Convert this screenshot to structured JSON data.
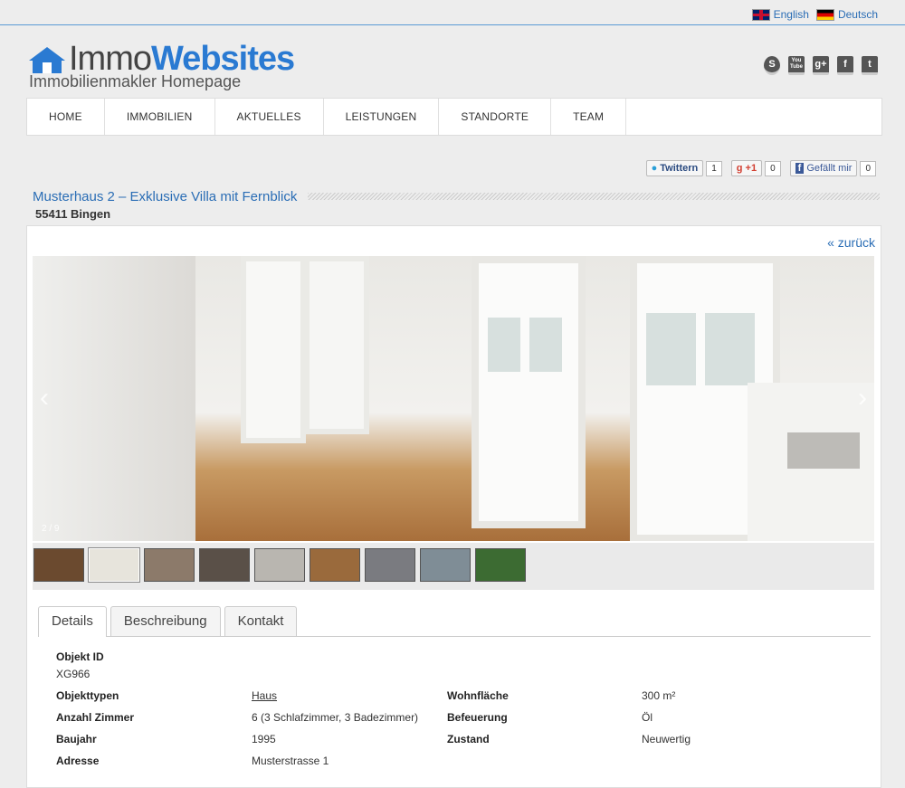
{
  "lang": {
    "english": "English",
    "deutsch": "Deutsch"
  },
  "logo": {
    "part1": "Immo",
    "part2": "Websites",
    "tagline": "Immobilienmakler Homepage"
  },
  "social": [
    "S",
    "You Tube",
    "g+",
    "f",
    "t"
  ],
  "nav": [
    "HOME",
    "IMMOBILIEN",
    "AKTUELLES",
    "LEISTUNGEN",
    "STANDORTE",
    "TEAM"
  ],
  "share": {
    "twitter": "Twittern",
    "twitter_count": "1",
    "gplus": "+1",
    "gplus_count": "0",
    "fb": "Gefällt mir",
    "fb_count": "0"
  },
  "listing": {
    "title": "Musterhaus 2 – Exklusive Villa mit Fernblick",
    "location": "55411 Bingen",
    "back": "« zurück",
    "counter": "2 / 9"
  },
  "tabs": [
    "Details",
    "Beschreibung",
    "Kontakt"
  ],
  "details": {
    "objekt_id_label": "Objekt ID",
    "objekt_id": "XG966",
    "objekttypen_label": "Objekttypen",
    "objekttypen": "Haus",
    "zimmer_label": "Anzahl Zimmer",
    "zimmer": "6  (3 Schlafzimmer, 3 Badezimmer)",
    "baujahr_label": "Baujahr",
    "baujahr": "1995",
    "adresse_label": "Adresse",
    "adresse": "Musterstrasse 1",
    "wohnflaeche_label": "Wohnfläche",
    "wohnflaeche": "300 m²",
    "befeuerung_label": "Befeuerung",
    "befeuerung": "Öl",
    "zustand_label": "Zustand",
    "zustand": "Neuwertig"
  },
  "colors": {
    "accent": "#2a7ad2",
    "link": "#2a6db5"
  },
  "thumbs": [
    "#6b4a2f",
    "#e7e4dc",
    "#8c7a6a",
    "#5a5048",
    "#b9b6b0",
    "#9a6a3c",
    "#7a7b80",
    "#7f8d96",
    "#3c6b32"
  ]
}
